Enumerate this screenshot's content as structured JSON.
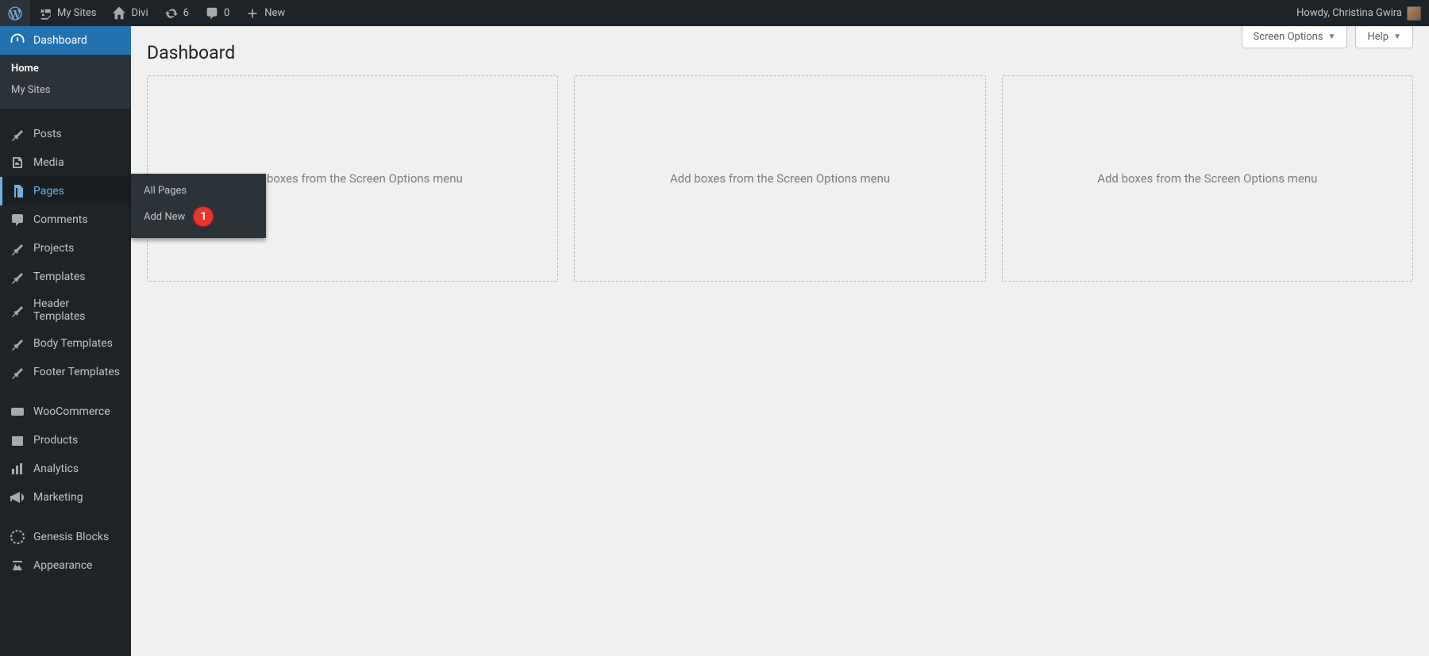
{
  "adminbar": {
    "my_sites": "My Sites",
    "site_name": "Divi",
    "update_count": "6",
    "comment_count": "0",
    "new_label": "New",
    "greeting": "Howdy, Christina Gwira"
  },
  "page": {
    "title": "Dashboard"
  },
  "screen_meta": {
    "screen_options": "Screen Options",
    "help": "Help"
  },
  "placeholders": {
    "box1": "Add boxes from the Screen Options menu",
    "box2": "Add boxes from the Screen Options menu",
    "box3": "Add boxes from the Screen Options menu"
  },
  "sidebar": {
    "dashboard": "Dashboard",
    "dashboard_sub": {
      "home": "Home",
      "my_sites": "My Sites"
    },
    "posts": "Posts",
    "media": "Media",
    "pages": "Pages",
    "comments": "Comments",
    "projects": "Projects",
    "templates": "Templates",
    "header_templates": "Header Templates",
    "body_templates": "Body Templates",
    "footer_templates": "Footer Templates",
    "woocommerce": "WooCommerce",
    "products": "Products",
    "analytics": "Analytics",
    "marketing": "Marketing",
    "genesis_blocks": "Genesis Blocks",
    "appearance": "Appearance"
  },
  "flyout": {
    "all_pages": "All Pages",
    "add_new": "Add New",
    "annotation_number": "1"
  }
}
